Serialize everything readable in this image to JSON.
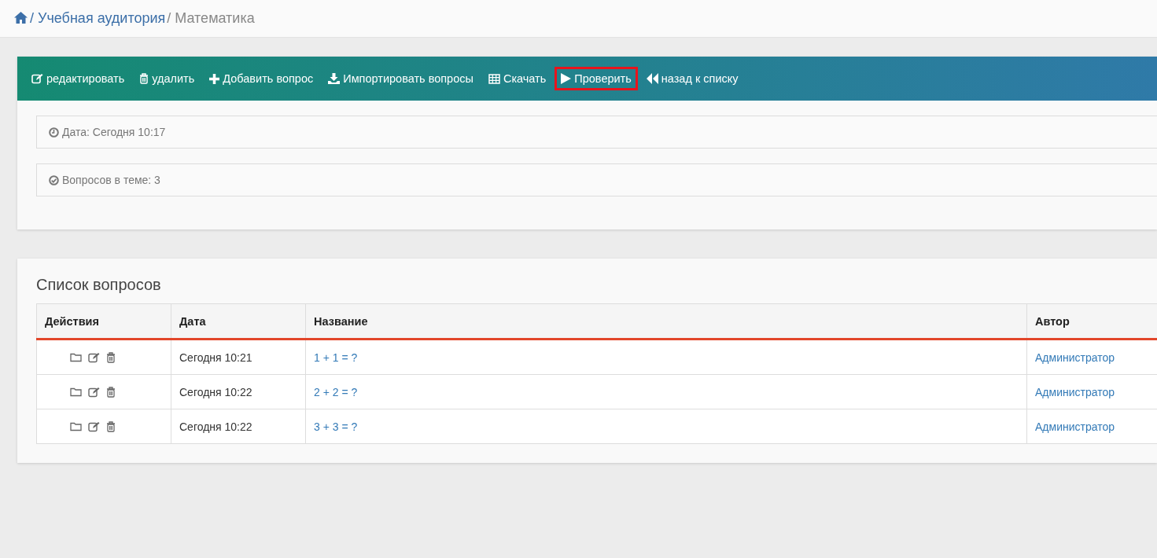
{
  "breadcrumb": {
    "items": [
      {
        "label": "/ Учебная аудитория",
        "link": true
      },
      {
        "label": "/ Математика",
        "link": false
      }
    ]
  },
  "toolbar": [
    {
      "kind": "edit",
      "label": "редактировать",
      "highlighted": false
    },
    {
      "kind": "delete",
      "label": "удалить",
      "highlighted": false
    },
    {
      "kind": "add",
      "label": "Добавить вопрос",
      "highlighted": false
    },
    {
      "kind": "import",
      "label": "Импортировать вопросы",
      "highlighted": false
    },
    {
      "kind": "download",
      "label": "Скачать",
      "highlighted": false
    },
    {
      "kind": "check",
      "label": "Проверить",
      "highlighted": true
    },
    {
      "kind": "back",
      "label": "назад к списку",
      "highlighted": false
    }
  ],
  "info": [
    {
      "kind": "date",
      "text": "Дата: Сегодня 10:17"
    },
    {
      "kind": "count",
      "text": "Вопросов в теме: 3"
    }
  ],
  "questions": {
    "title": "Список вопросов",
    "columns": [
      "Действия",
      "Дата",
      "Название",
      "Автор"
    ],
    "rows": [
      {
        "date": "Сегодня 10:21",
        "name": "1 + 1 = ?",
        "author": "Администратор"
      },
      {
        "date": "Сегодня 10:22",
        "name": "2 + 2 = ?",
        "author": "Администратор"
      },
      {
        "date": "Сегодня 10:22",
        "name": "3 + 3 = ?",
        "author": "Администратор"
      }
    ]
  }
}
